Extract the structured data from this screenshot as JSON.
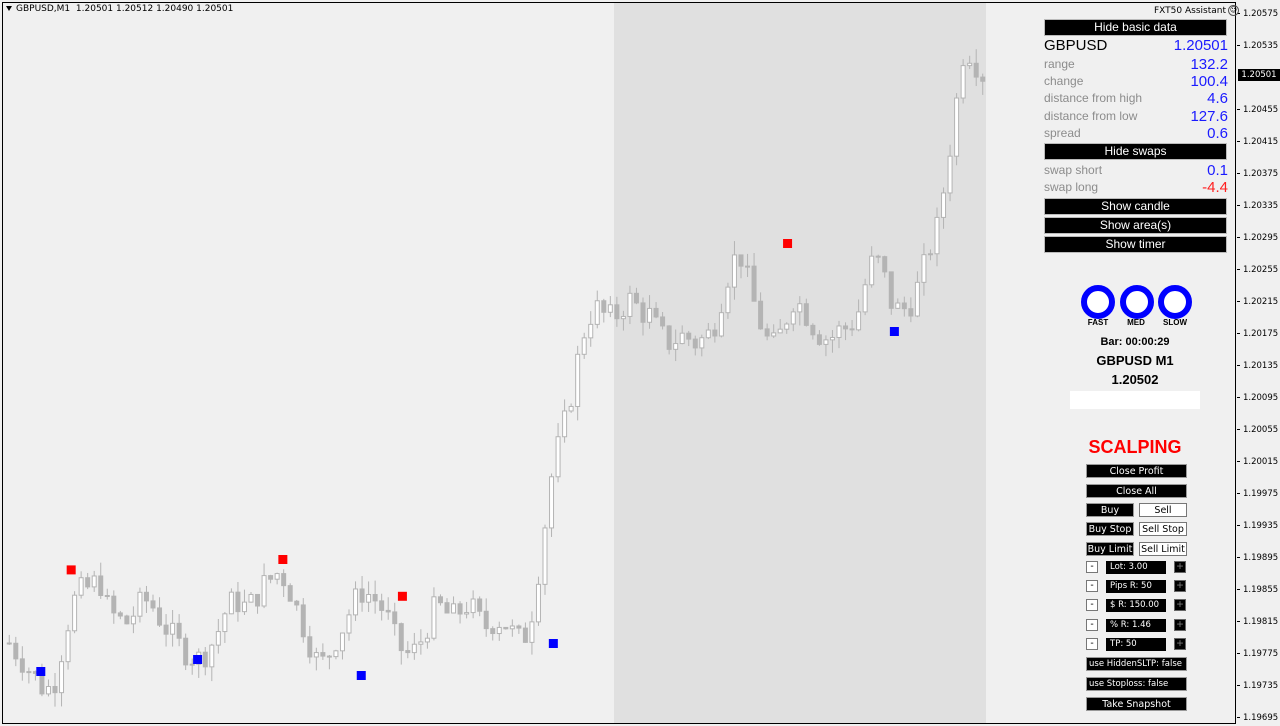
{
  "chart": {
    "symbol_header": "GBPUSD,M1",
    "ohlc_header": "1.20501 1.20512 1.20490 1.20501",
    "current_price_tag": "1.20501",
    "price_axis": [
      "1.20575",
      "1.20535",
      "1.20455",
      "1.20415",
      "1.20375",
      "1.20335",
      "1.20295",
      "1.20255",
      "1.20215",
      "1.20175",
      "1.20135",
      "1.20095",
      "1.20055",
      "1.20015",
      "1.19975",
      "1.19935",
      "1.19895",
      "1.19855",
      "1.19815",
      "1.19775",
      "1.19735",
      "1.19695"
    ],
    "colors": {
      "candle": "#b4b4b4",
      "shade": "#e0e0e0",
      "buy_marker": "#0000ff",
      "sell_marker": "#ff0000"
    }
  },
  "chart_data": {
    "type": "candlestick",
    "title": "GBPUSD,M1",
    "ylim": [
      1.19685,
      1.20595
    ],
    "y_ticks": [
      1.20575,
      1.20535,
      1.20455,
      1.20415,
      1.20375,
      1.20335,
      1.20295,
      1.20255,
      1.20215,
      1.20175,
      1.20135,
      1.20095,
      1.20055,
      1.20015,
      1.19975,
      1.19935,
      1.19895,
      1.19855,
      1.19815,
      1.19775,
      1.19735,
      1.19695
    ],
    "closes_approx": [
      1.1979,
      1.19775,
      1.1976,
      1.19745,
      1.1973,
      1.1974,
      1.1979,
      1.1984,
      1.19855,
      1.1986,
      1.1987,
      1.1983,
      1.1982,
      1.19815,
      1.1983,
      1.19845,
      1.19835,
      1.19815,
      1.198,
      1.19785,
      1.19775,
      1.1977,
      1.1978,
      1.198,
      1.1983,
      1.19845,
      1.19835,
      1.1984,
      1.1986,
      1.1987,
      1.1988,
      1.1986,
      1.1983,
      1.198,
      1.1977,
      1.19765,
      1.1979,
      1.1981,
      1.19835,
      1.19855,
      1.1985,
      1.1984,
      1.1982,
      1.1979,
      1.19775,
      1.1978,
      1.198,
      1.1983,
      1.19835,
      1.1982,
      1.1983,
      1.1984,
      1.1982,
      1.1981,
      1.1982,
      1.19815,
      1.198,
      1.1979,
      1.1983,
      1.199,
      1.1999,
      1.2004,
      1.2008,
      1.2014,
      1.2019,
      1.2021,
      1.202,
      1.20195,
      1.2021,
      1.2022,
      1.20205,
      1.202,
      1.2018,
      1.20165,
      1.2017,
      1.20175,
      1.20165,
      1.2017,
      1.2018,
      1.2022,
      1.2026,
      1.2028,
      1.2024,
      1.202,
      1.2017,
      1.2016,
      1.2019,
      1.2022,
      1.2021,
      1.2019,
      1.20175,
      1.2017,
      1.2018,
      1.20185,
      1.20195,
      1.2024,
      1.20275,
      1.2025,
      1.2021,
      1.20205,
      1.20215,
      1.2024,
      1.2028,
      1.2031,
      1.2038,
      1.2046,
      1.2054,
      1.2052,
      1.20501
    ],
    "markers": {
      "sell": [
        [
          0.066,
          1.19882
        ],
        [
          0.282,
          1.19895
        ],
        [
          0.404,
          1.19849
        ],
        [
          0.797,
          1.2029
        ]
      ],
      "buy": [
        [
          0.035,
          1.19755
        ],
        [
          0.195,
          1.1977
        ],
        [
          0.362,
          1.1975
        ],
        [
          0.558,
          1.1979
        ],
        [
          0.906,
          1.2018
        ]
      ]
    }
  },
  "panel": {
    "assistant_title": "FXT50 Assistant",
    "hide_basic_data": "Hide basic data",
    "symbol": "GBPUSD",
    "symbol_price": "1.20501",
    "rows": [
      {
        "label": "range",
        "value": "132.2"
      },
      {
        "label": "change",
        "value": "100.4"
      },
      {
        "label": "distance from high",
        "value": "4.6"
      },
      {
        "label": "distance from low",
        "value": "127.6"
      },
      {
        "label": "spread",
        "value": "0.6"
      }
    ],
    "hide_swaps": "Hide swaps",
    "swaps": [
      {
        "label": "swap short",
        "value": "0.1"
      },
      {
        "label": "swap long",
        "value": "-4.4"
      }
    ],
    "show_candle": "Show candle",
    "show_areas": "Show area(s)",
    "show_timer": "Show timer",
    "speed_labels": [
      "FAST",
      "MED",
      "SLOW"
    ],
    "bar_timer": "Bar: 00:00:29",
    "symbol_tf": "GBPUSD M1",
    "bid": "1.20502"
  },
  "scalping": {
    "title": "SCALPING",
    "close_profit": "Close Profit",
    "close_all": "Close All",
    "buy": "Buy",
    "sell": "Sell",
    "buy_stop": "Buy Stop",
    "sell_stop": "Sell Stop",
    "buy_limit": "Buy Limit",
    "sell_limit": "Sell Limit",
    "minus": "-",
    "plus": "+",
    "fields": [
      "Lot: 3.00",
      "Pips R: 50",
      "$ R: 150.00",
      "% R: 1.46",
      "TP: 50"
    ],
    "use_hidden_sltp": "use HiddenSLTP: false",
    "use_stoploss": "use Stoploss: false",
    "take_snapshot": "Take Snapshot"
  }
}
